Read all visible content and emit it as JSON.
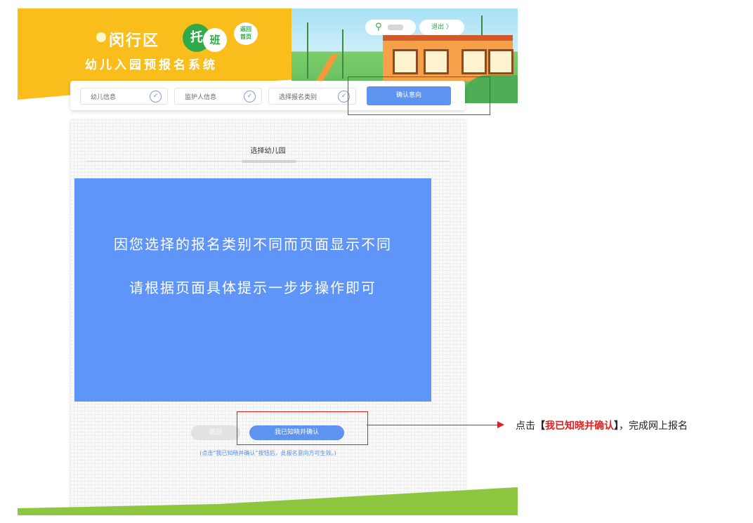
{
  "header": {
    "logo_line1": "闵行区",
    "logo_tuo": "托",
    "logo_ban": "班",
    "bubble_line1": "返回",
    "bubble_line2": "首页",
    "logo_line2": "幼儿入园预报名系统",
    "user_icon": "user-icon",
    "logout_label": "退出 〉"
  },
  "steps": [
    {
      "label": "幼儿信息",
      "check": "✓"
    },
    {
      "label": "监护人信息",
      "check": "✓"
    },
    {
      "label": "选择报名类别",
      "check": "✓"
    },
    {
      "label": "确认意向"
    }
  ],
  "card": {
    "title": "选择幼儿园",
    "banner_line1": "因您选择的报名类别不同而页面显示不同",
    "banner_line2": "请根据页面具体提示一步步操作即可",
    "back_button": "返回",
    "confirm_button": "我已知晓并确认",
    "note": "(点击“我已知晓并确认”按钮后，此报名意向方可生效。)"
  },
  "annotation": {
    "prefix": "点击",
    "open_bracket": "【",
    "highlight": "我已知晓并确认",
    "close_bracket": "】",
    "suffix": "，完成网上报名"
  },
  "colors": {
    "header_yellow": "#f9be1c",
    "primary_blue": "#5f93f0",
    "banner_blue": "#5f95f8",
    "annotation_red": "#e02020",
    "brand_green": "#2fa94a"
  }
}
